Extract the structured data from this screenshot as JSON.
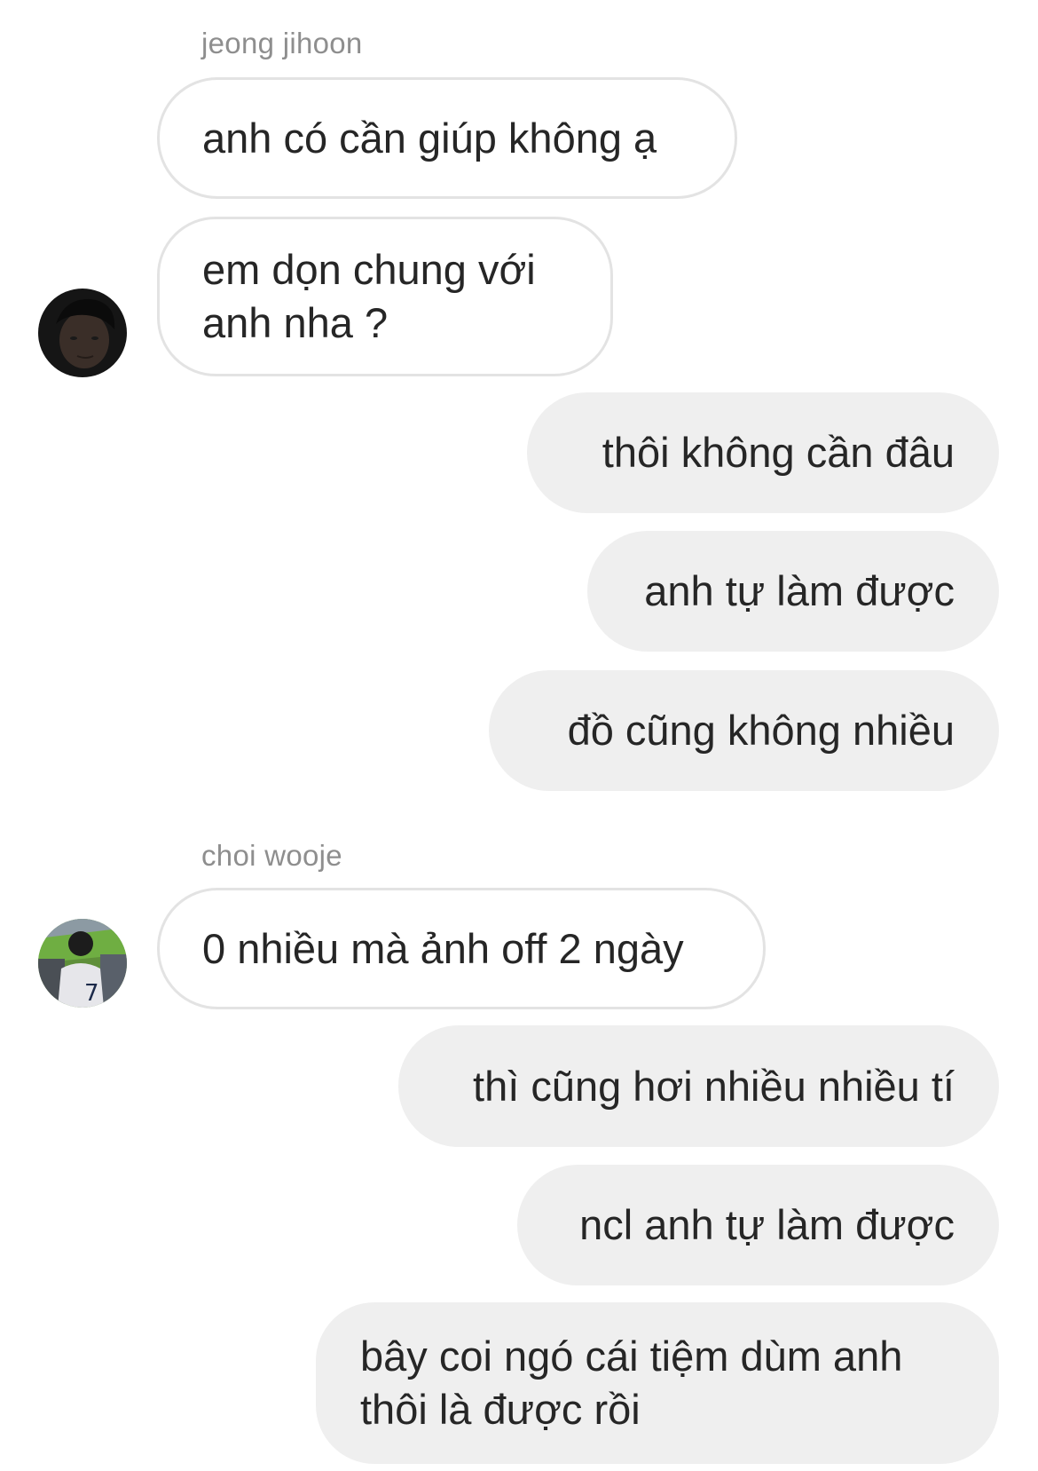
{
  "conversation": {
    "groups": [
      {
        "sender": "jeong jihoon",
        "avatar_icon": "user-avatar-dark-portrait",
        "messages": [
          "anh có cần giúp không ạ",
          "em dọn chung với\nanh nha ?"
        ]
      },
      {
        "sender": "self",
        "messages": [
          "thôi không cần đâu",
          "anh tự làm được",
          "đồ cũng không nhiều"
        ]
      },
      {
        "sender": "choi wooje",
        "avatar_icon": "user-avatar-stadium-photo",
        "messages": [
          "0 nhiều mà ảnh off 2 ngày"
        ]
      },
      {
        "sender": "self",
        "messages": [
          "thì cũng hơi nhiều nhiều tí",
          "ncl anh tự làm được",
          "bây coi ngó cái tiệm dùm anh\nthôi là được rồi"
        ]
      }
    ]
  },
  "colors": {
    "incoming_bubble_bg": "#ffffff",
    "incoming_bubble_border": "#e3e3e3",
    "outgoing_bubble_bg": "#efefef",
    "message_text": "#262626",
    "sender_name_text": "#8e8e8e"
  }
}
